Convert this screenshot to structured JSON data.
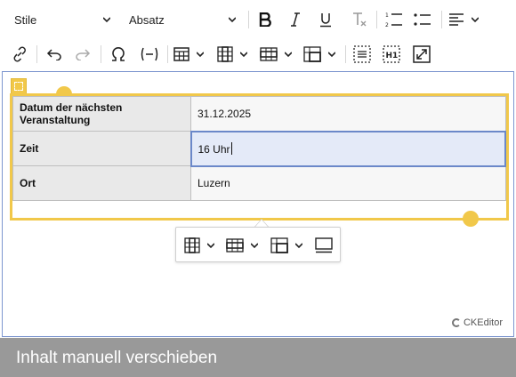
{
  "toolbar": {
    "style_dropdown": "Stile",
    "heading_dropdown": "Absatz",
    "icons": [
      "bold-icon",
      "italic-icon",
      "underline-icon",
      "remove-format-icon",
      "numbered-list-icon",
      "bulleted-list-icon",
      "align-icon",
      "link-icon",
      "undo-icon",
      "redo-icon",
      "special-characters-icon",
      "placeholder-icon",
      "insert-table-icon",
      "table-column-icon",
      "table-row-icon",
      "merge-cells-icon",
      "show-blocks-icon",
      "source-heading-icon",
      "fullscreen-icon"
    ],
    "colors": {
      "text": "#222222",
      "separator": "#d6d6d6"
    }
  },
  "editor": {
    "frame_color": "#7d96cf",
    "widget_color": "#f1c84a",
    "table": {
      "rows": [
        {
          "label": "Datum der nächsten Veranstaltung",
          "value": "31.12.2025"
        },
        {
          "label": "Zeit",
          "value": "16 Uhr",
          "active": true
        },
        {
          "label": "Ort",
          "value": "Luzern"
        }
      ]
    },
    "balloon_icons": [
      "table-column-icon",
      "table-row-icon",
      "merge-cells-icon",
      "table-properties-icon"
    ],
    "brand": "CKEditor"
  },
  "footer": {
    "text": "Inhalt manuell verschieben",
    "background": "#999999"
  }
}
